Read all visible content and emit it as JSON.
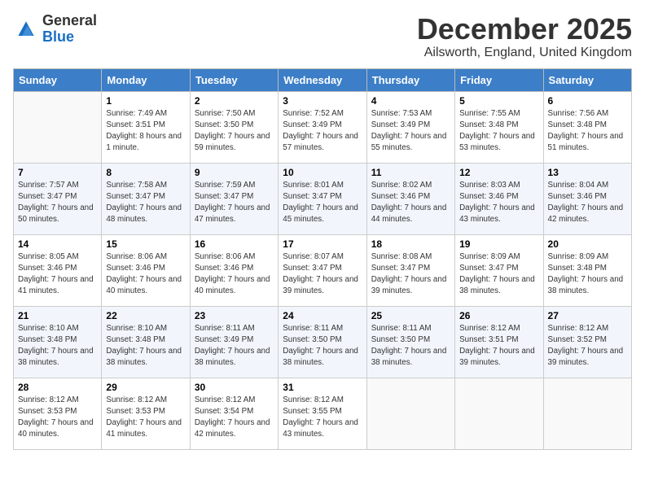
{
  "logo": {
    "general": "General",
    "blue": "Blue"
  },
  "header": {
    "month": "December 2025",
    "location": "Ailsworth, England, United Kingdom"
  },
  "weekdays": [
    "Sunday",
    "Monday",
    "Tuesday",
    "Wednesday",
    "Thursday",
    "Friday",
    "Saturday"
  ],
  "weeks": [
    [
      {
        "day": "",
        "sunrise": "",
        "sunset": "",
        "daylight": ""
      },
      {
        "day": "1",
        "sunrise": "Sunrise: 7:49 AM",
        "sunset": "Sunset: 3:51 PM",
        "daylight": "Daylight: 8 hours and 1 minute."
      },
      {
        "day": "2",
        "sunrise": "Sunrise: 7:50 AM",
        "sunset": "Sunset: 3:50 PM",
        "daylight": "Daylight: 7 hours and 59 minutes."
      },
      {
        "day": "3",
        "sunrise": "Sunrise: 7:52 AM",
        "sunset": "Sunset: 3:49 PM",
        "daylight": "Daylight: 7 hours and 57 minutes."
      },
      {
        "day": "4",
        "sunrise": "Sunrise: 7:53 AM",
        "sunset": "Sunset: 3:49 PM",
        "daylight": "Daylight: 7 hours and 55 minutes."
      },
      {
        "day": "5",
        "sunrise": "Sunrise: 7:55 AM",
        "sunset": "Sunset: 3:48 PM",
        "daylight": "Daylight: 7 hours and 53 minutes."
      },
      {
        "day": "6",
        "sunrise": "Sunrise: 7:56 AM",
        "sunset": "Sunset: 3:48 PM",
        "daylight": "Daylight: 7 hours and 51 minutes."
      }
    ],
    [
      {
        "day": "7",
        "sunrise": "Sunrise: 7:57 AM",
        "sunset": "Sunset: 3:47 PM",
        "daylight": "Daylight: 7 hours and 50 minutes."
      },
      {
        "day": "8",
        "sunrise": "Sunrise: 7:58 AM",
        "sunset": "Sunset: 3:47 PM",
        "daylight": "Daylight: 7 hours and 48 minutes."
      },
      {
        "day": "9",
        "sunrise": "Sunrise: 7:59 AM",
        "sunset": "Sunset: 3:47 PM",
        "daylight": "Daylight: 7 hours and 47 minutes."
      },
      {
        "day": "10",
        "sunrise": "Sunrise: 8:01 AM",
        "sunset": "Sunset: 3:47 PM",
        "daylight": "Daylight: 7 hours and 45 minutes."
      },
      {
        "day": "11",
        "sunrise": "Sunrise: 8:02 AM",
        "sunset": "Sunset: 3:46 PM",
        "daylight": "Daylight: 7 hours and 44 minutes."
      },
      {
        "day": "12",
        "sunrise": "Sunrise: 8:03 AM",
        "sunset": "Sunset: 3:46 PM",
        "daylight": "Daylight: 7 hours and 43 minutes."
      },
      {
        "day": "13",
        "sunrise": "Sunrise: 8:04 AM",
        "sunset": "Sunset: 3:46 PM",
        "daylight": "Daylight: 7 hours and 42 minutes."
      }
    ],
    [
      {
        "day": "14",
        "sunrise": "Sunrise: 8:05 AM",
        "sunset": "Sunset: 3:46 PM",
        "daylight": "Daylight: 7 hours and 41 minutes."
      },
      {
        "day": "15",
        "sunrise": "Sunrise: 8:06 AM",
        "sunset": "Sunset: 3:46 PM",
        "daylight": "Daylight: 7 hours and 40 minutes."
      },
      {
        "day": "16",
        "sunrise": "Sunrise: 8:06 AM",
        "sunset": "Sunset: 3:46 PM",
        "daylight": "Daylight: 7 hours and 40 minutes."
      },
      {
        "day": "17",
        "sunrise": "Sunrise: 8:07 AM",
        "sunset": "Sunset: 3:47 PM",
        "daylight": "Daylight: 7 hours and 39 minutes."
      },
      {
        "day": "18",
        "sunrise": "Sunrise: 8:08 AM",
        "sunset": "Sunset: 3:47 PM",
        "daylight": "Daylight: 7 hours and 39 minutes."
      },
      {
        "day": "19",
        "sunrise": "Sunrise: 8:09 AM",
        "sunset": "Sunset: 3:47 PM",
        "daylight": "Daylight: 7 hours and 38 minutes."
      },
      {
        "day": "20",
        "sunrise": "Sunrise: 8:09 AM",
        "sunset": "Sunset: 3:48 PM",
        "daylight": "Daylight: 7 hours and 38 minutes."
      }
    ],
    [
      {
        "day": "21",
        "sunrise": "Sunrise: 8:10 AM",
        "sunset": "Sunset: 3:48 PM",
        "daylight": "Daylight: 7 hours and 38 minutes."
      },
      {
        "day": "22",
        "sunrise": "Sunrise: 8:10 AM",
        "sunset": "Sunset: 3:48 PM",
        "daylight": "Daylight: 7 hours and 38 minutes."
      },
      {
        "day": "23",
        "sunrise": "Sunrise: 8:11 AM",
        "sunset": "Sunset: 3:49 PM",
        "daylight": "Daylight: 7 hours and 38 minutes."
      },
      {
        "day": "24",
        "sunrise": "Sunrise: 8:11 AM",
        "sunset": "Sunset: 3:50 PM",
        "daylight": "Daylight: 7 hours and 38 minutes."
      },
      {
        "day": "25",
        "sunrise": "Sunrise: 8:11 AM",
        "sunset": "Sunset: 3:50 PM",
        "daylight": "Daylight: 7 hours and 38 minutes."
      },
      {
        "day": "26",
        "sunrise": "Sunrise: 8:12 AM",
        "sunset": "Sunset: 3:51 PM",
        "daylight": "Daylight: 7 hours and 39 minutes."
      },
      {
        "day": "27",
        "sunrise": "Sunrise: 8:12 AM",
        "sunset": "Sunset: 3:52 PM",
        "daylight": "Daylight: 7 hours and 39 minutes."
      }
    ],
    [
      {
        "day": "28",
        "sunrise": "Sunrise: 8:12 AM",
        "sunset": "Sunset: 3:53 PM",
        "daylight": "Daylight: 7 hours and 40 minutes."
      },
      {
        "day": "29",
        "sunrise": "Sunrise: 8:12 AM",
        "sunset": "Sunset: 3:53 PM",
        "daylight": "Daylight: 7 hours and 41 minutes."
      },
      {
        "day": "30",
        "sunrise": "Sunrise: 8:12 AM",
        "sunset": "Sunset: 3:54 PM",
        "daylight": "Daylight: 7 hours and 42 minutes."
      },
      {
        "day": "31",
        "sunrise": "Sunrise: 8:12 AM",
        "sunset": "Sunset: 3:55 PM",
        "daylight": "Daylight: 7 hours and 43 minutes."
      },
      {
        "day": "",
        "sunrise": "",
        "sunset": "",
        "daylight": ""
      },
      {
        "day": "",
        "sunrise": "",
        "sunset": "",
        "daylight": ""
      },
      {
        "day": "",
        "sunrise": "",
        "sunset": "",
        "daylight": ""
      }
    ]
  ]
}
